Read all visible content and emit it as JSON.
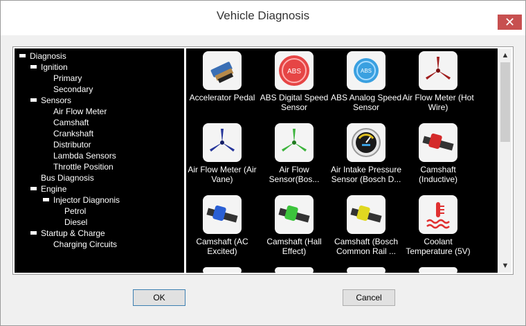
{
  "window": {
    "title": "Vehicle Diagnosis",
    "close_glyph": "✕"
  },
  "tree": {
    "root": "Diagnosis",
    "ignition": "Ignition",
    "primary": "Primary",
    "secondary": "Secondary",
    "sensors": "Sensors",
    "air_flow_meter": "Air Flow Meter",
    "camshaft": "Camshaft",
    "crankshaft": "Crankshaft",
    "distributor": "Distributor",
    "lambda_sensors": "Lambda Sensors",
    "throttle_position": "Throttle Position",
    "bus_diagnosis": "Bus Diagnosis",
    "engine": "Engine",
    "injector_diagnosis": "Injector Diagnonis",
    "petrol": "Petrol",
    "diesel": "Diesel",
    "startup_charge": "Startup & Charge",
    "charging_circuits": "Charging Circuits"
  },
  "tiles": {
    "t1": {
      "line1": "Accelerator Pedal",
      "line2": "",
      "icon": "accelerator-pedal-icon"
    },
    "t2": {
      "line1": "ABS Digital Speed",
      "line2": "Sensor",
      "badge": "ABS",
      "icon": "abs-digital-icon"
    },
    "t3": {
      "line1": "ABS Analog Speed",
      "line2": "Sensor",
      "badge": "ABS",
      "icon": "abs-analog-icon"
    },
    "t4": {
      "line1": "Air Flow Meter (Hot",
      "line2": "Wire)",
      "icon": "propeller-icon"
    },
    "t5": {
      "line1": "Air Flow Meter (Air",
      "line2": "Vane)",
      "icon": "propeller-icon"
    },
    "t6": {
      "line1": "Air Flow",
      "line2": "Sensor(Bos...",
      "icon": "propeller-icon"
    },
    "t7": {
      "line1": "Air Intake Pressure",
      "line2": "Sensor (Bosch D...",
      "icon": "pressure-gauge-icon"
    },
    "t8": {
      "line1": "Camshaft",
      "line2": "(Inductive)",
      "icon": "camshaft-icon"
    },
    "t9": {
      "line1": "Camshaft (AC",
      "line2": "Excited)",
      "icon": "camshaft-icon"
    },
    "t10": {
      "line1": "Camshaft (Hall",
      "line2": "Effect)",
      "icon": "camshaft-icon"
    },
    "t11": {
      "line1": "Camshaft (Bosch",
      "line2": "Common Rail ...",
      "icon": "camshaft-icon"
    },
    "t12": {
      "line1": "Coolant",
      "line2": "Temperature (5V)",
      "icon": "coolant-temperature-icon"
    }
  },
  "colors": {
    "accent_red": "#c75050",
    "abs_red": "#e64545",
    "abs_blue": "#3aa0e0",
    "prop_red": "#a01e1e",
    "prop_blue": "#24349a",
    "prop_green": "#3cb43c"
  },
  "scroll": {
    "up": "▲",
    "down": "▼"
  },
  "buttons": {
    "ok": "OK",
    "cancel": "Cancel"
  }
}
